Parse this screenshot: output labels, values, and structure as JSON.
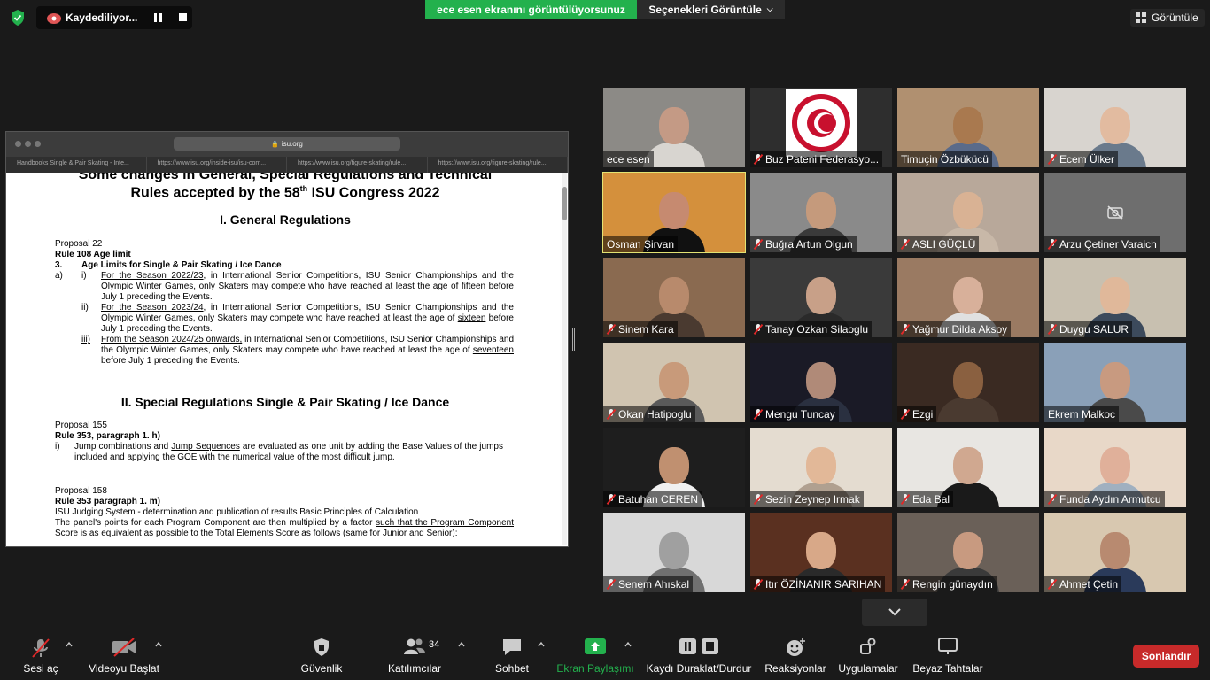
{
  "top_bar": {
    "recording_label": "Kaydediliyor...",
    "share_banner": "ece esen ekranını görüntülüyorsunuz",
    "view_options": "Seçenekleri Görüntüle",
    "view_button": "Görüntüle"
  },
  "shared_screen": {
    "browser_address": "isu.org",
    "tabs": [
      "Handbooks Single & Pair Skating - Inte...",
      "https://www.isu.org/inside-isu/isu-com...",
      "https://www.isu.org/figure-skating/rule...",
      "https://www.isu.org/figure-skating/rule..."
    ],
    "doc": {
      "title_line1": "Some changes in General, Special Regulations and Technical",
      "title_line2_pre": "Rules accepted by the 58",
      "title_line2_sup": "th",
      "title_line2_post": " ISU Congress 2022",
      "section1": "I. General Regulations",
      "p22_title": "Proposal 22",
      "p22_rule": "Rule 108 Age limit",
      "p22_num": "3.",
      "p22_heading": "Age Limits for Single & Pair Skating / Ice Dance",
      "p22_a": "a)",
      "p22_i": "i)",
      "p22_i_u": "For the Season 2022/23",
      "p22_i_text": ", in International Senior Competitions, ISU Senior Championships and the Olympic Winter Games, only Skaters may compete who have reached at least the age of fifteen before July 1 preceding the Events.",
      "p22_ii": "ii)",
      "p22_ii_u": "For the Season 2023/24",
      "p22_ii_text1": ", in International Senior Competitions, ISU Senior Championships and the Olympic Winter Games, only Skaters may compete who have reached at least the age of ",
      "p22_ii_u2": "sixteen",
      "p22_ii_text2": " before July 1 preceding the Events.",
      "p22_iii": "iii)",
      "p22_iii_u": "From the Season 2024/25 onwards,",
      "p22_iii_text1": " in International Senior Competitions, ISU Senior Championships and the Olympic Winter Games, only Skaters may compete who have reached at least the age of ",
      "p22_iii_u2": "seventeen",
      "p22_iii_text2": " before July 1 preceding the Events.",
      "section2": "II. Special Regulations Single & Pair Skating / Ice Dance",
      "p155_title": "Proposal 155",
      "p155_rule": "Rule 353, paragraph 1. h)",
      "p155_i": "i)",
      "p155_text1": "Jump combinations and ",
      "p155_u": "Jump Sequences",
      "p155_text2": " are evaluated as one unit by adding the Base Values of the jumps included and applying the GOE with the numerical value of the most difficult jump.",
      "p158_title": "Proposal 158",
      "p158_rule": "Rule 353 paragraph 1. m)",
      "p158_line": "ISU Judging System - determination and publication of results Basic Principles of Calculation",
      "p158_text1": "The panel's points for each Program Component are then multiplied by a factor ",
      "p158_u": "such that the Program Component Score is as equivalent as possible ",
      "p158_text2": "to the Total Elements Score as follows (same for Junior and Senior):"
    }
  },
  "participants": [
    {
      "name": "ece esen",
      "muted": false,
      "bg": "#8c8a86",
      "skin": "#c49a85",
      "shirt": "#d8d5d0"
    },
    {
      "name": "Buz Pateni Federasyo...",
      "muted": true,
      "bg": "#2e2e2e",
      "logo": true
    },
    {
      "name": "Timuçin Özbükücü",
      "muted": false,
      "bg": "#b09070",
      "skin": "#a9794f",
      "shirt": "#5a6b8a"
    },
    {
      "name": "Ecem Ülker",
      "muted": true,
      "bg": "#d8d4cf",
      "skin": "#e2bba0",
      "shirt": "#6a7a8c"
    },
    {
      "name": "Osman Şirvan",
      "muted": false,
      "bg": "#d4903c",
      "skin": "#c68a70",
      "shirt": "#111111",
      "active": true
    },
    {
      "name": "Buğra Artun Olgun",
      "muted": true,
      "bg": "#8a8a8a",
      "skin": "#c59a7c",
      "shirt": "#3a3a3a"
    },
    {
      "name": "ASLI GÜÇLÜ",
      "muted": true,
      "bg": "#b8a89a",
      "skin": "#d9b294",
      "shirt": "#c8b8a8"
    },
    {
      "name": "Arzu Çetiner Varaich",
      "muted": true,
      "bg": "#6e6e6e",
      "camera_off": true
    },
    {
      "name": "Sinem Kara",
      "muted": true,
      "bg": "#8a6a50",
      "skin": "#b88a6c",
      "shirt": "#4a3a30"
    },
    {
      "name": "Tanay Ozkan Silaoglu",
      "muted": true,
      "bg": "#3a3a3a",
      "skin": "#c8a088",
      "shirt": "#2a2a2a"
    },
    {
      "name": "Yağmur Dilda Aksoy",
      "muted": true,
      "bg": "#9a7a62",
      "skin": "#d8b09a",
      "shirt": "#e0e0e0"
    },
    {
      "name": "Duygu SALUR",
      "muted": true,
      "bg": "#c8c0b0",
      "skin": "#e0b89a",
      "shirt": "#3c4a5c"
    },
    {
      "name": "Okan Hatipoglu",
      "muted": true,
      "bg": "#d0c4b0",
      "skin": "#c89a7a",
      "shirt": "#5a5a5a"
    },
    {
      "name": "Mengu Tuncay",
      "muted": true,
      "bg": "#1a1a26",
      "skin": "#b08a78",
      "shirt": "#2a3040"
    },
    {
      "name": "Ezgi",
      "muted": true,
      "bg": "#3a2a22",
      "skin": "#8a6040",
      "shirt": "#4a3a30"
    },
    {
      "name": "Ekrem Malkoc",
      "muted": false,
      "bg": "#8aa0b8",
      "skin": "#c89a80",
      "shirt": "#4a4a4a"
    },
    {
      "name": "Batuhan CEREN",
      "muted": true,
      "bg": "#1e1e1e",
      "skin": "#c09070",
      "shirt": "#f0f0f0"
    },
    {
      "name": "Sezin Zeynep Irmak",
      "muted": true,
      "bg": "#e4dcd0",
      "skin": "#e2b898",
      "shirt": "#b0a090"
    },
    {
      "name": "Eda Bal",
      "muted": true,
      "bg": "#e8e6e2",
      "skin": "#d0a890",
      "shirt": "#1a1a1a"
    },
    {
      "name": "Funda Aydın Armutcu",
      "muted": true,
      "bg": "#e8d8c8",
      "skin": "#e0b09a",
      "shirt": "#a0b0c0"
    },
    {
      "name": "Senem Ahıskal",
      "muted": true,
      "bg": "#d8d8d8",
      "skin": "#a0a0a0",
      "shirt": "#707070"
    },
    {
      "name": "Itır ÖZİNANIR SARIHAN",
      "muted": true,
      "bg": "#5a3020",
      "skin": "#d8a888",
      "shirt": "#2a2a2a"
    },
    {
      "name": "Rengin günaydın",
      "muted": true,
      "bg": "#6a6058",
      "skin": "#c89a80",
      "shirt": "#3a3a3a"
    },
    {
      "name": "Ahmet Çetin",
      "muted": true,
      "bg": "#d8c8b0",
      "skin": "#b88a70",
      "shirt": "#2a3a5a"
    }
  ],
  "toolbar": {
    "unmute": "Sesi aç",
    "start_video": "Videoyu Başlat",
    "security": "Güvenlik",
    "participants": "Katılımcılar",
    "participants_count": "34",
    "chat": "Sohbet",
    "share_screen": "Ekran Paylaşımı",
    "pause_recording": "Kaydı Duraklat/Durdur",
    "reactions": "Reaksiyonlar",
    "apps": "Uygulamalar",
    "whiteboards": "Beyaz Tahtalar",
    "end": "Sonlandır"
  },
  "colors": {
    "share_green": "#23b14d",
    "end_red": "#c72a2a",
    "active_speaker": "#e3e373",
    "muted_red": "#e02828"
  }
}
